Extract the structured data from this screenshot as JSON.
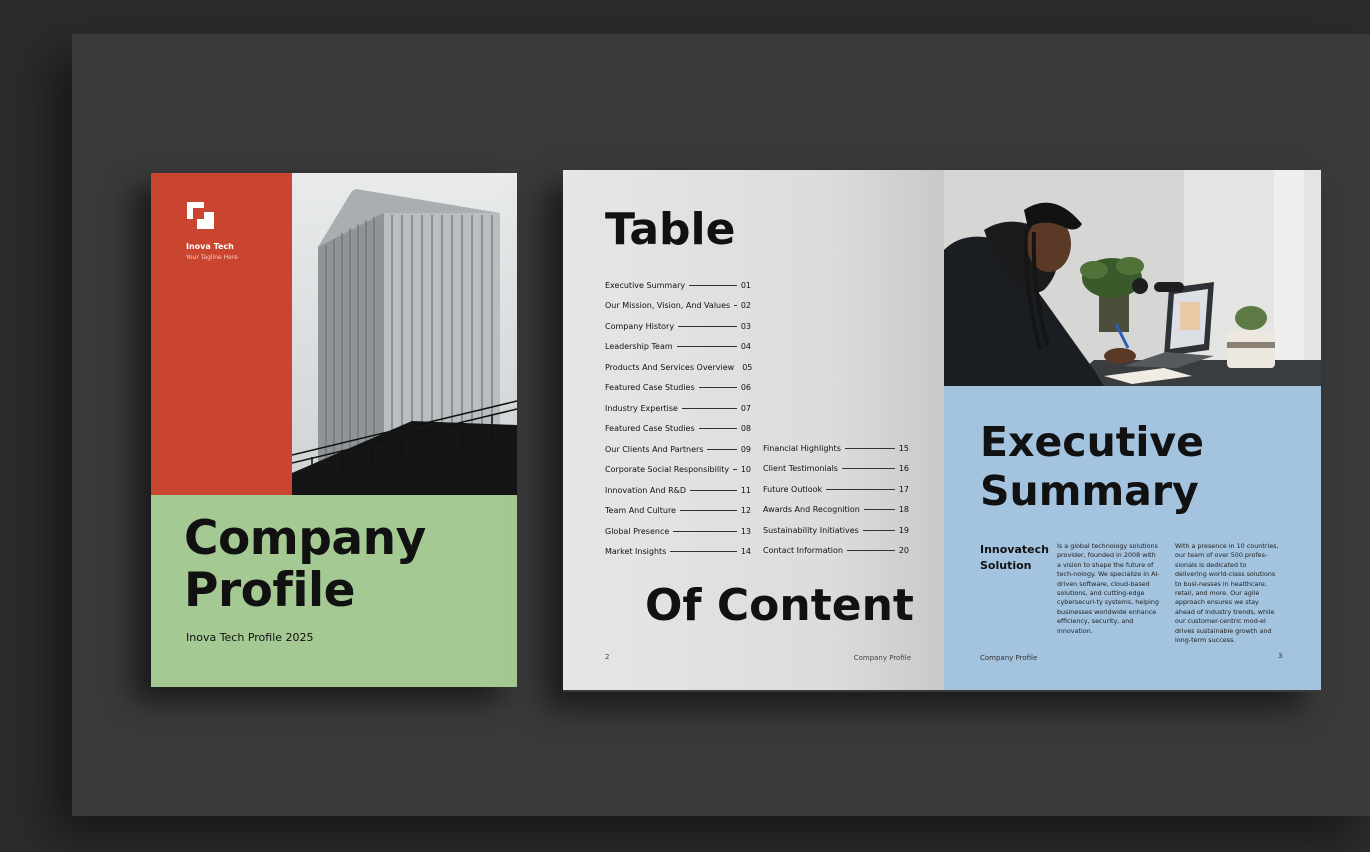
{
  "cover": {
    "brand": "Inova Tech",
    "tagline": "Your Tagline Here",
    "title_line1": "Company",
    "title_line2": "Profile",
    "subtitle": "Inova Tech Profile 2025"
  },
  "toc": {
    "heading": "Table",
    "footer_heading": "Of Content",
    "left_entries": [
      {
        "label": "Executive Summary",
        "page": "01"
      },
      {
        "label": "Our Mission, Vision, And Values",
        "page": "02"
      },
      {
        "label": "Company History",
        "page": "03"
      },
      {
        "label": "Leadership Team",
        "page": "04"
      },
      {
        "label": "Products And Services Overview",
        "page": "05"
      },
      {
        "label": "Featured Case Studies",
        "page": "06"
      },
      {
        "label": "Industry Expertise",
        "page": "07"
      },
      {
        "label": "Featured Case Studies",
        "page": "08"
      },
      {
        "label": "Our Clients And Partners",
        "page": "09"
      },
      {
        "label": "Corporate Social Responsibility",
        "page": "10"
      },
      {
        "label": "Innovation And R&D",
        "page": "11"
      },
      {
        "label": "Team And Culture",
        "page": "12"
      },
      {
        "label": "Global Presence",
        "page": "13"
      },
      {
        "label": "Market Insights",
        "page": "14"
      }
    ],
    "right_entries": [
      {
        "label": "Financial Highlights",
        "page": "15"
      },
      {
        "label": "Client Testimonials",
        "page": "16"
      },
      {
        "label": "Future Outlook",
        "page": "17"
      },
      {
        "label": "Awards And Recognition",
        "page": "18"
      },
      {
        "label": "Sustainability Initiatives",
        "page": "19"
      },
      {
        "label": "Contact Information",
        "page": "20"
      }
    ],
    "page_number": "2",
    "footer_label": "Company Profile"
  },
  "executive": {
    "title_line1": "Executive",
    "title_line2": "Summary",
    "heading_line1": "Innovatech",
    "heading_line2": "Solution",
    "col1": "Is a global technology solutions provider, founded in 2008 with a vision to shape the future of tech-nology. We specialize in AI-driven software, cloud-based solutions, and cutting-edge cybersecuri-ty systems, helping businesses worldwide enhance efficiency, security, and innovation.",
    "col2": "With a presence in 10 countries, our team of over 500 profes-sionals is dedicated to delivering world-class solutions to busi-nesses in healthcare, retail, and more. Our agile approach ensures we stay ahead of industry trends, while our customer-centric mod-el drives sustainable growth and long-term success.",
    "page_number": "3",
    "footer_label": "Company Profile"
  },
  "colors": {
    "background": "#2b2b2b",
    "board": "#3a3a3a",
    "cover_red": "#c9452f",
    "cover_green": "#a5c993",
    "page_grey": "#e2e2e2",
    "page_blue": "#a3c3df"
  },
  "icons": {
    "logo": "overlapping-squares-logo"
  }
}
